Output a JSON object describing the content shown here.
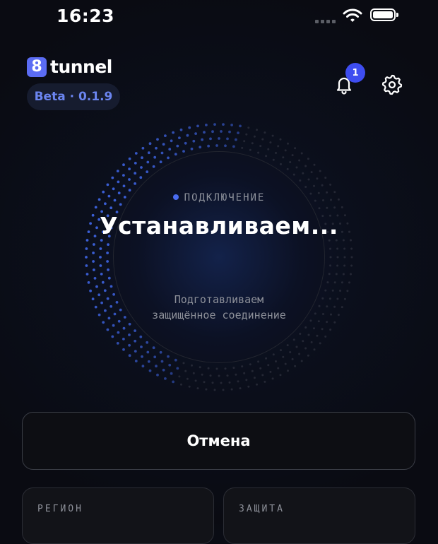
{
  "status_bar": {
    "time": "16:23"
  },
  "header": {
    "logo_mark": "8",
    "logo_text": "tunnel",
    "version_badge": "Beta · 0.1.9",
    "notification_count": "1"
  },
  "connection": {
    "status_label": "ПОДКЛЮЧЕНИЕ",
    "headline": "Устанавливаем...",
    "subtitle_line1": "Подготавливаем",
    "subtitle_line2": "защищённое соединение"
  },
  "actions": {
    "cancel_label": "Отмена"
  },
  "info_cards": [
    {
      "label": "РЕГИОН"
    },
    {
      "label": "ЗАЩИТА"
    }
  ],
  "colors": {
    "accent": "#3e4df0",
    "logo": "#5b6cf3",
    "badge_text": "#6b85f0",
    "status_dot": "#4a6cf0"
  },
  "icons": [
    "cellular-signal-icon",
    "wifi-icon",
    "battery-icon",
    "bell-icon",
    "gear-icon"
  ]
}
